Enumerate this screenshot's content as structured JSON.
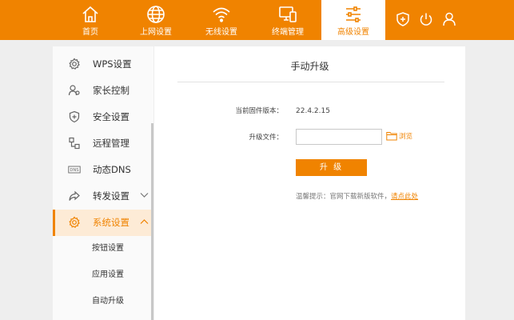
{
  "colors": {
    "accent": "#f08300",
    "active_bg": "#fdebd6",
    "page_bg": "#eeeeee"
  },
  "topnav": {
    "items": [
      {
        "label": "首页",
        "icon": "home-icon"
      },
      {
        "label": "上网设置",
        "icon": "globe-icon"
      },
      {
        "label": "无线设置",
        "icon": "wifi-icon"
      },
      {
        "label": "终端管理",
        "icon": "devices-icon"
      },
      {
        "label": "高级设置",
        "icon": "sliders-icon",
        "active": true
      }
    ],
    "right_icons": [
      "shield-plus-icon",
      "power-icon",
      "user-icon"
    ]
  },
  "sidebar": {
    "items": [
      {
        "label": "WPS设置",
        "icon": "gear-icon"
      },
      {
        "label": "家长控制",
        "icon": "parent-user-icon"
      },
      {
        "label": "安全设置",
        "icon": "shield-icon"
      },
      {
        "label": "远程管理",
        "icon": "remote-icon"
      },
      {
        "label": "动态DNS",
        "icon": "dns-icon"
      },
      {
        "label": "转发设置",
        "icon": "forward-icon",
        "expandable": true
      },
      {
        "label": "系统设置",
        "icon": "system-gear-icon",
        "active": true,
        "expanded": true
      }
    ],
    "subitems": [
      {
        "label": "按钮设置"
      },
      {
        "label": "应用设置"
      },
      {
        "label": "自动升级"
      }
    ]
  },
  "main": {
    "title": "手动升级",
    "firmware_label": "当前固件版本：",
    "firmware_value": "22.4.2.15",
    "file_label": "升级文件：",
    "file_value": "",
    "browse_label": "浏览",
    "upgrade_button": "升 级",
    "tip_text": "温馨提示：官网下载新版软件，",
    "tip_link": "请点此处"
  }
}
